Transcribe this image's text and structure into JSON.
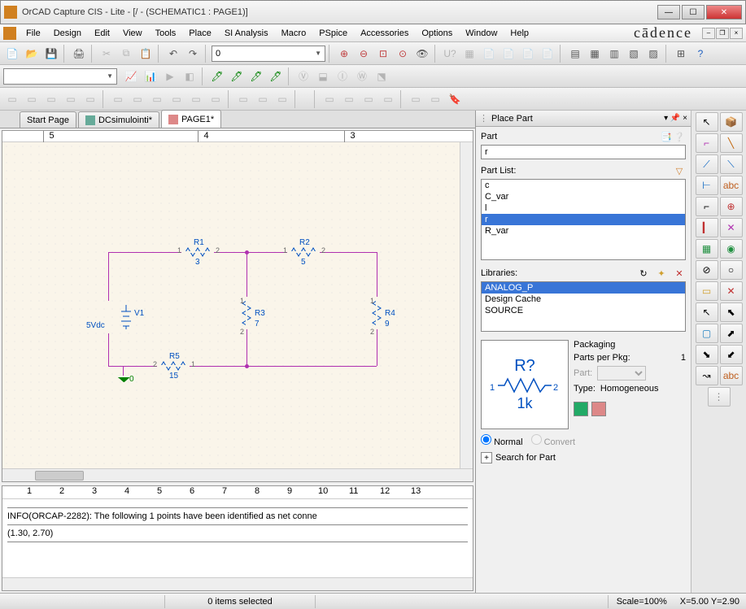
{
  "title": "OrCAD Capture CIS - Lite - [/ - (SCHEMATIC1 : PAGE1)]",
  "brand": "cādence",
  "menu": [
    "File",
    "Design",
    "Edit",
    "View",
    "Tools",
    "Place",
    "SI Analysis",
    "Macro",
    "PSpice",
    "Accessories",
    "Options",
    "Window",
    "Help"
  ],
  "zoom_value": "0",
  "tabs": [
    {
      "label": "Start Page",
      "active": false
    },
    {
      "label": "DCsimulointi*",
      "active": false
    },
    {
      "label": "PAGE1*",
      "active": true
    }
  ],
  "ruler_marks": [
    "5",
    "4",
    "3"
  ],
  "schematic": {
    "gnd": "0",
    "v_source": {
      "name": "V1",
      "value": "5Vdc"
    },
    "resistors": [
      {
        "name": "R1",
        "value": "3",
        "pins": [
          "1",
          "2"
        ]
      },
      {
        "name": "R2",
        "value": "5",
        "pins": [
          "1",
          "2"
        ]
      },
      {
        "name": "R3",
        "value": "7",
        "pins": [
          "1",
          "2"
        ]
      },
      {
        "name": "R4",
        "value": "9",
        "pins": [
          "1",
          "2"
        ]
      },
      {
        "name": "R5",
        "value": "15",
        "pins": [
          "2",
          "1"
        ]
      }
    ]
  },
  "info_ruler": [
    "1",
    "2",
    "3",
    "4",
    "5",
    "6",
    "7",
    "8",
    "9",
    "10",
    "11",
    "12",
    "13"
  ],
  "info_msg": "INFO(ORCAP-2282): The following 1 points have been identified as net conne",
  "info_coord": "(1.30, 2.70)",
  "place_part": {
    "title": "Place Part",
    "part_label": "Part",
    "search_value": "r",
    "list_label": "Part List:",
    "items": [
      "c",
      "C_var",
      "l",
      "r",
      "R_var"
    ],
    "selected_item": "r",
    "lib_label": "Libraries:",
    "libs": [
      "ANALOG_P",
      "Design Cache",
      "SOURCE"
    ],
    "selected_lib": "ANALOG_P",
    "preview_name": "R?",
    "preview_value": "1k",
    "preview_pins": [
      "1",
      "2"
    ],
    "packaging_label": "Packaging",
    "parts_per_pkg_label": "Parts per Pkg:",
    "parts_per_pkg": "1",
    "part_select_label": "Part:",
    "type_label": "Type:",
    "type_value": "Homogeneous",
    "mode_normal": "Normal",
    "mode_convert": "Convert",
    "search_label": "Search for Part"
  },
  "status": {
    "items_selected": "0 items selected",
    "scale": "Scale=100%",
    "coords": "X=5.00  Y=2.90"
  }
}
